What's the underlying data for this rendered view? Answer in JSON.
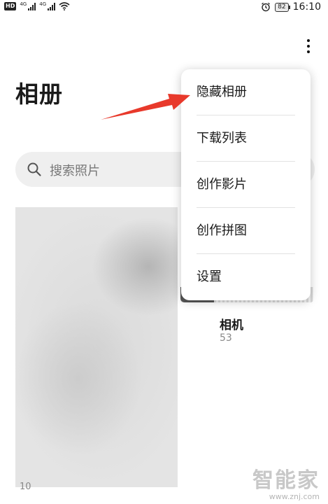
{
  "status_bar": {
    "hd": "HD",
    "net1": "4G",
    "net2": "4G",
    "battery": "82",
    "time": "16:10"
  },
  "header": {
    "title": "相册",
    "more_icon": "more-vertical-icon"
  },
  "search": {
    "placeholder": "搜索照片",
    "icon": "search-icon"
  },
  "albums": [
    {
      "count": "10"
    },
    {
      "name": "相机",
      "count": "53"
    }
  ],
  "menu": {
    "items": [
      {
        "label": "隐藏相册"
      },
      {
        "label": "下载列表"
      },
      {
        "label": "创作影片"
      },
      {
        "label": "创作拼图"
      },
      {
        "label": "设置"
      }
    ]
  },
  "annotation": {
    "arrow_color": "#e8392b"
  },
  "watermark": {
    "logo": "智能家",
    "url": "www.znj.com"
  }
}
